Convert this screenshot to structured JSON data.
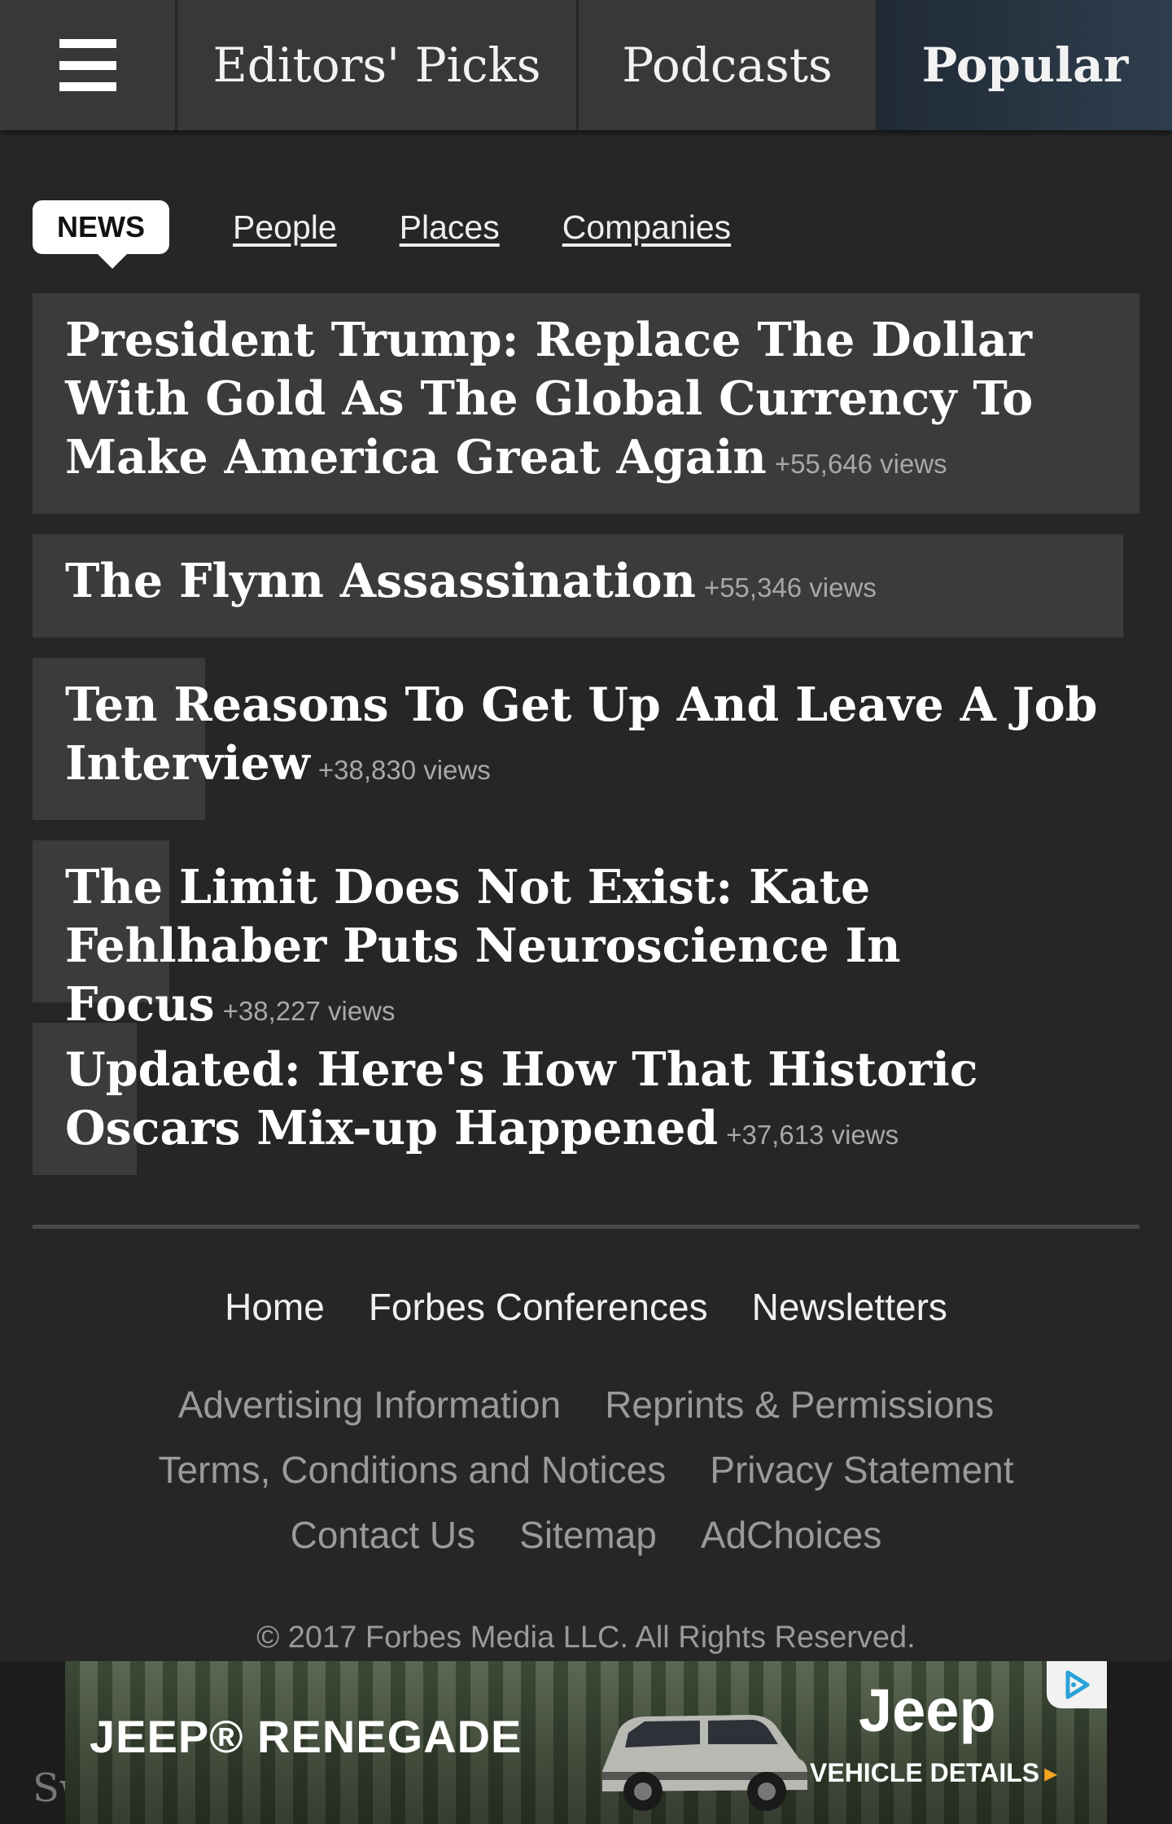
{
  "nav": {
    "menu_icon": "hamburger-menu-icon",
    "editors_picks": "Editors' Picks",
    "podcasts": "Podcasts",
    "popular": "Popular"
  },
  "tabs": {
    "news": "NEWS",
    "people": "People",
    "places": "Places",
    "companies": "Companies"
  },
  "articles": [
    {
      "title": "President Trump: Replace The Dollar With Gold As The Global Currency To Make America Great Again",
      "views": "+55,646 views"
    },
    {
      "title": "The Flynn Assassination",
      "views": "+55,346 views"
    },
    {
      "title": "Ten Reasons To Get Up And Leave A Job Interview",
      "views": "+38,830 views"
    },
    {
      "title": "The Limit Does Not Exist: Kate Fehlhaber Puts Neuroscience In Focus",
      "views": "+38,227 views"
    },
    {
      "title": "Updated: Here's How That Historic Oscars Mix-up Happened",
      "views": "+37,613 views"
    }
  ],
  "footer": {
    "main_links": [
      "Home",
      "Forbes Conferences",
      "Newsletters"
    ],
    "links_row1": [
      "Advertising Information",
      "Reprints & Permissions"
    ],
    "links_row2": [
      "Terms, Conditions and Notices",
      "Privacy Statement"
    ],
    "links_row3": [
      "Contact Us",
      "Sitemap",
      "AdChoices"
    ],
    "copyright": "©  2017 Forbes Media LLC. All Rights Reserved."
  },
  "bottom": {
    "partial_text": "Sw"
  },
  "ad": {
    "model": "JEEP® RENEGADE",
    "brand": "Jeep",
    "cta": "VEHICLE DETAILS",
    "cta_arrow": "▸",
    "choices_icon": "adchoices-icon"
  }
}
